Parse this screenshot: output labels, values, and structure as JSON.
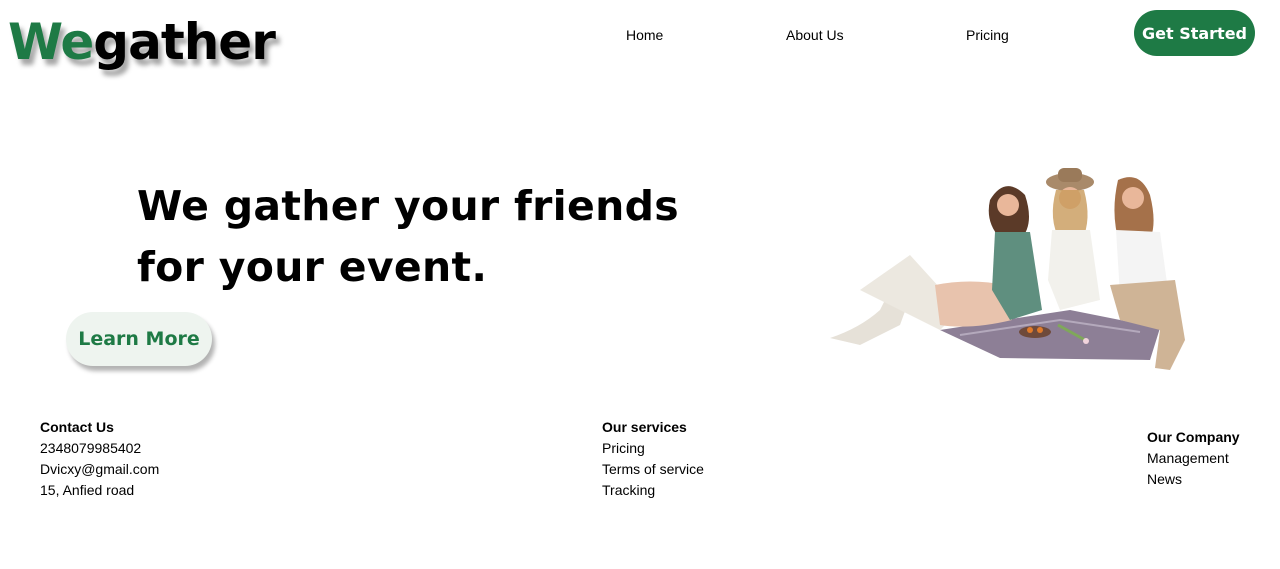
{
  "brand": {
    "logo_part1": "We",
    "logo_part2": "gather",
    "primary_color": "#1e7a45"
  },
  "nav": {
    "links": [
      "Home",
      "About Us",
      "Pricing"
    ],
    "cta_label": "Get Started"
  },
  "hero": {
    "title_line1": "We gather your friends",
    "title_line2": "for your event.",
    "cta_label": "Learn More",
    "image_icon": "friends-picnic-photo"
  },
  "footer": {
    "contact": {
      "heading": "Contact Us",
      "items": [
        "2348079985402",
        "Dvicxy@gmail.com",
        "15, Anfied road"
      ]
    },
    "services": {
      "heading": "Our services",
      "items": [
        "Pricing",
        "Terms of service",
        "Tracking"
      ]
    },
    "company": {
      "heading": "Our Company",
      "items": [
        "Management",
        "News"
      ]
    }
  }
}
